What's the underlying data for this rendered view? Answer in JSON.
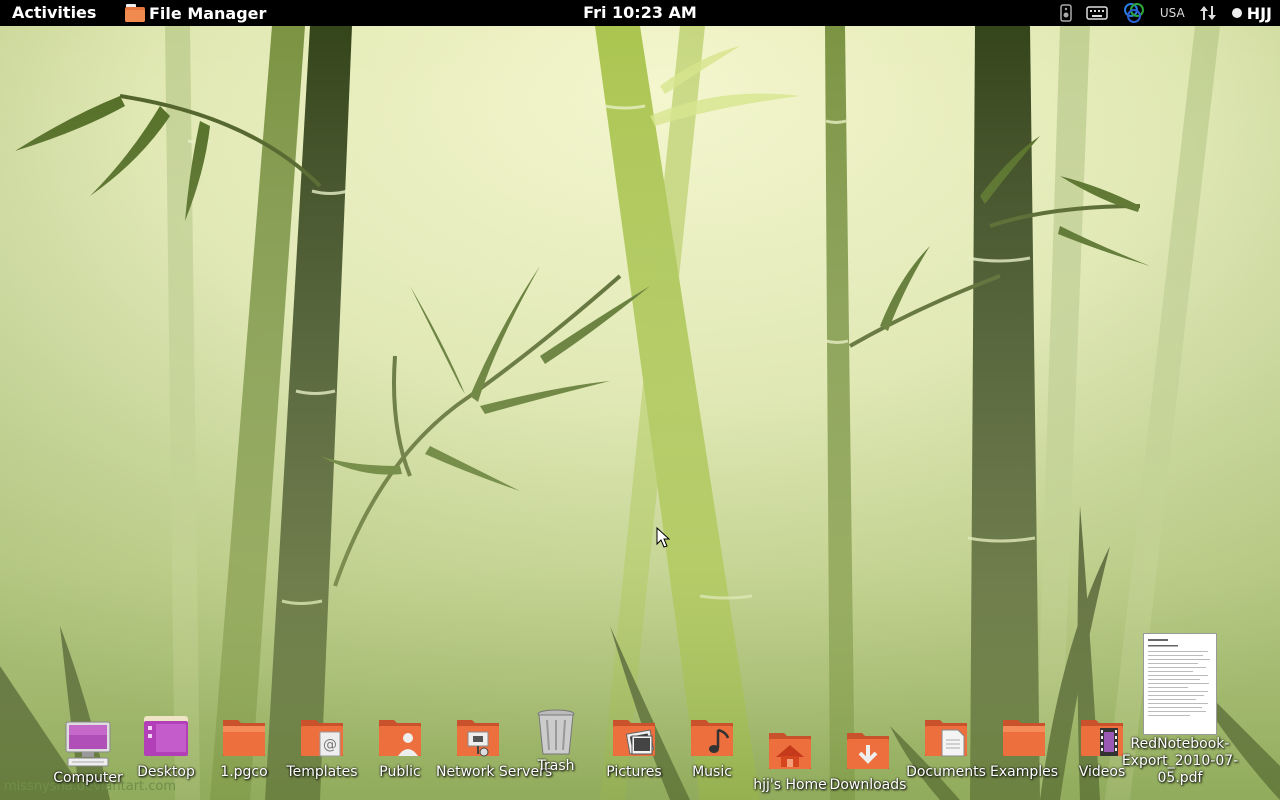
{
  "topbar": {
    "activities": "Activities",
    "app_name": "File Manager",
    "clock": "Fri 10:23 AM",
    "keyboard_layout": "USA",
    "user": "HJJ"
  },
  "desktop": {
    "watermark": "missnysha.deviantart.com",
    "icons": [
      {
        "label": "Computer",
        "icon": "computer-icon"
      },
      {
        "label": "Desktop",
        "icon": "desktop-folder-icon"
      },
      {
        "label": "1.pgco",
        "icon": "folder-icon"
      },
      {
        "label": "Templates",
        "icon": "templates-folder-icon"
      },
      {
        "label": "Public",
        "icon": "public-folder-icon"
      },
      {
        "label": "Network Servers",
        "icon": "network-servers-icon"
      },
      {
        "label": "Trash",
        "icon": "trash-icon"
      },
      {
        "label": "Pictures",
        "icon": "pictures-folder-icon"
      },
      {
        "label": "Music",
        "icon": "music-folder-icon"
      },
      {
        "label": "hjj's Home",
        "icon": "home-folder-icon"
      },
      {
        "label": "Downloads",
        "icon": "downloads-folder-icon"
      },
      {
        "label": "Documents",
        "icon": "documents-folder-icon"
      },
      {
        "label": "Examples",
        "icon": "examples-folder-icon"
      },
      {
        "label": "Videos",
        "icon": "videos-folder-icon"
      },
      {
        "label": "RedNotebook-Export_2010-07-05.pdf",
        "icon": "pdf-thumbnail-icon"
      }
    ]
  },
  "colors": {
    "topbar": "#000000",
    "folder": "#e8663a",
    "wallpaper_light": "#eef2b8",
    "bamboo_dark": "#2f3d14"
  }
}
